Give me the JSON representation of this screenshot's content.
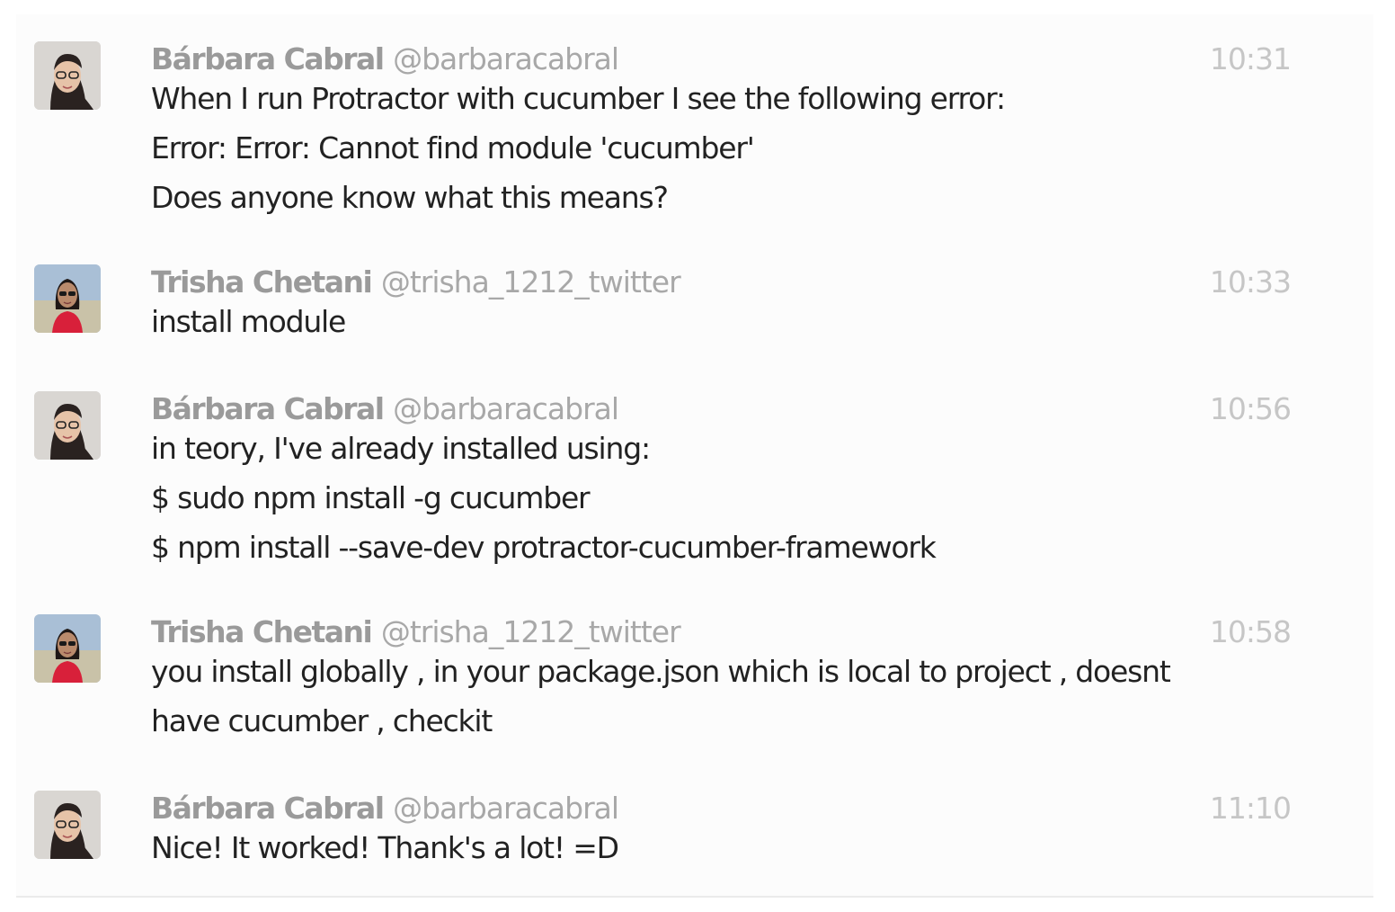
{
  "messages": [
    {
      "author": "Bárbara Cabral",
      "username": "@barbaracabral",
      "time": "10:31",
      "avatar_icon": "user-avatar-barbara",
      "lines": [
        "When I run Protractor with cucumber I see the following error:",
        "Error: Error: Cannot find module 'cucumber'",
        "Does anyone know what this means?"
      ]
    },
    {
      "author": "Trisha Chetani",
      "username": "@trisha_1212_twitter",
      "time": "10:33",
      "avatar_icon": "user-avatar-trisha",
      "lines": [
        "install module"
      ]
    },
    {
      "author": "Bárbara Cabral",
      "username": "@barbaracabral",
      "time": "10:56",
      "avatar_icon": "user-avatar-barbara",
      "lines": [
        "in teory, I've already installed using:",
        "$ sudo npm install -g cucumber",
        "$ npm install --save-dev protractor-cucumber-framework"
      ]
    },
    {
      "author": "Trisha Chetani",
      "username": "@trisha_1212_twitter",
      "time": "10:58",
      "avatar_icon": "user-avatar-trisha",
      "lines": [
        "you install globally , in your package.json which is local to project , doesnt",
        "have cucumber , checkit"
      ]
    },
    {
      "author": "Bárbara Cabral",
      "username": "@barbaracabral",
      "time": "11:10",
      "avatar_icon": "user-avatar-barbara",
      "lines": [
        "Nice! It worked! Thank's a lot! =D"
      ]
    }
  ]
}
